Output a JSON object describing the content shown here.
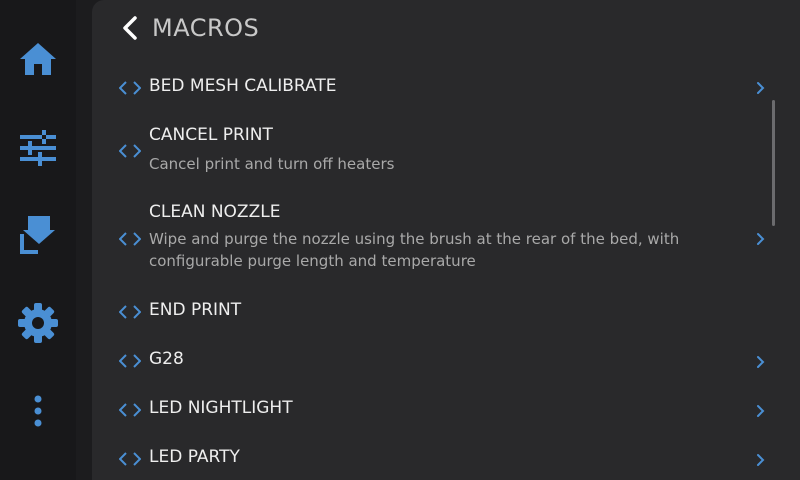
{
  "header": {
    "title": "MACROS"
  },
  "sidebar": {
    "items": [
      {
        "icon": "home-icon"
      },
      {
        "icon": "sliders-icon"
      },
      {
        "icon": "extruder-icon"
      },
      {
        "icon": "gear-icon"
      },
      {
        "icon": "more-vertical-icon"
      }
    ]
  },
  "macros": [
    {
      "name": "BED MESH CALIBRATE",
      "description": "",
      "has_chevron": true
    },
    {
      "name": "CANCEL PRINT",
      "description": "Cancel print and turn off heaters",
      "has_chevron": false
    },
    {
      "name": "CLEAN NOZZLE",
      "description": "Wipe and purge the nozzle using the brush at the rear of the bed, with configurable purge length and temperature",
      "has_chevron": true
    },
    {
      "name": "END PRINT",
      "description": "",
      "has_chevron": false
    },
    {
      "name": "G28",
      "description": "",
      "has_chevron": true
    },
    {
      "name": "LED NIGHTLIGHT",
      "description": "",
      "has_chevron": true
    },
    {
      "name": "LED PARTY",
      "description": "",
      "has_chevron": true
    }
  ],
  "colors": {
    "accent": "#4a8fd4",
    "panel": "#29292b",
    "sidebar": "#18181a",
    "text": "#eeeeee",
    "subtext": "#a9a9a9"
  }
}
